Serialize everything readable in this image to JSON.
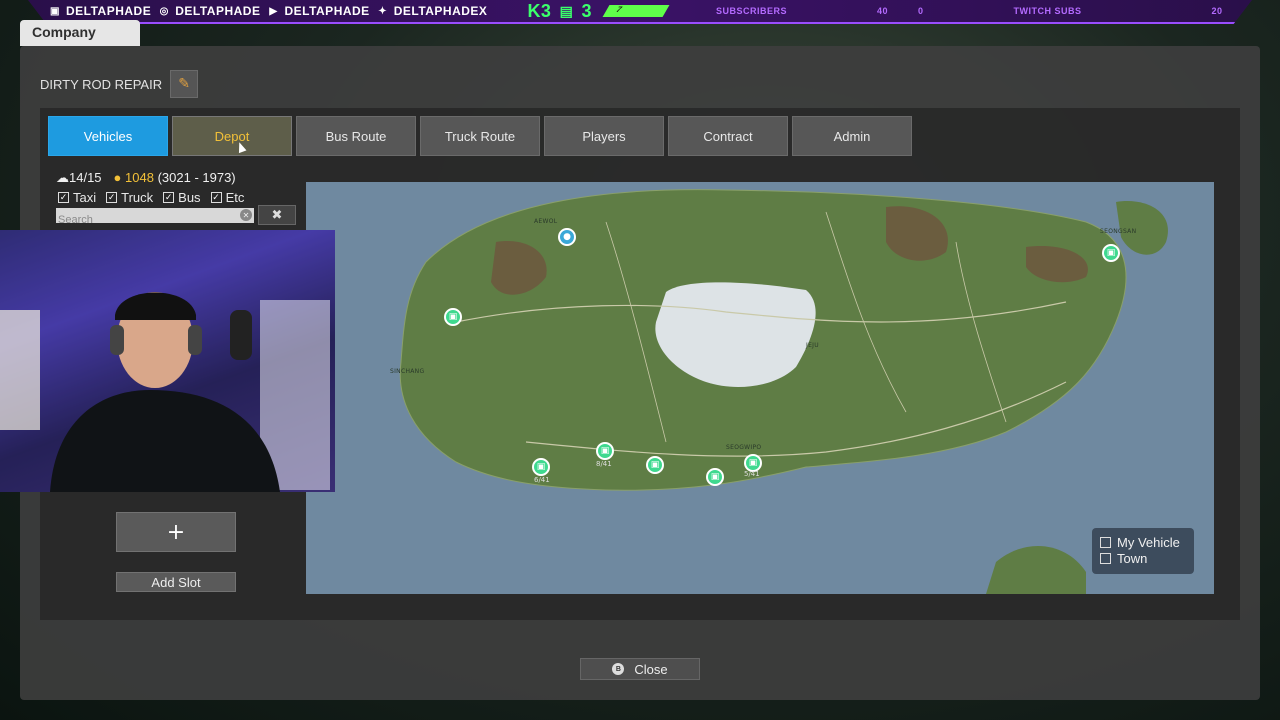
{
  "overlay": {
    "handles": [
      "DELTAPHADE",
      "DELTAPHADE",
      "DELTAPHADE",
      "DELTAPHADEX"
    ],
    "icons": [
      "twitch-icon",
      "instagram-icon",
      "youtube-icon",
      "twitter-icon"
    ],
    "stat_k": "K3",
    "stat_p": "3",
    "progress_value": "7",
    "subscribers_label": "SUBSCRIBERS",
    "subscribers_a": "40",
    "subscribers_b": "0",
    "twitch_subs_label": "TWITCH SUBS",
    "twitch_subs_value": "20"
  },
  "company_tab": "Company",
  "company_name": "DIRTY ROD REPAIR",
  "tabs": [
    {
      "label": "Vehicles"
    },
    {
      "label": "Depot"
    },
    {
      "label": "Bus Route"
    },
    {
      "label": "Truck Route"
    },
    {
      "label": "Players"
    },
    {
      "label": "Contract"
    },
    {
      "label": "Admin"
    }
  ],
  "stats": {
    "vehicles": "14/15",
    "coins": "1048",
    "coins_range": "(3021 - 1973)"
  },
  "filters": [
    "Taxi",
    "Truck",
    "Bus",
    "Etc"
  ],
  "search": {
    "placeholder": "Search",
    "value": ""
  },
  "add_button": "+",
  "add_slot": "Add Slot",
  "legend": {
    "my_vehicle": "My Vehicle",
    "town": "Town"
  },
  "map_labels": {
    "marker_labels": [
      "8/41",
      "6/41",
      "5/41"
    ],
    "towns": [
      "AEWOL",
      "SINCHANG",
      "SEONGSAN",
      "SEOGWIPO",
      "JEJU"
    ]
  },
  "close": "Close",
  "colors": {
    "active_tab": "#1e9be0",
    "hover_text": "#f2c038",
    "marker": "#3fd98f",
    "land": "#5f7d45",
    "water": "#6f89a0"
  }
}
